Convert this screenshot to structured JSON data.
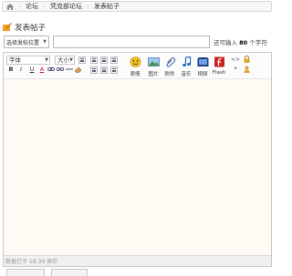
{
  "breadcrumb": {
    "items": [
      "论坛",
      "凭克部论坛",
      "发表帖子"
    ]
  },
  "header": {
    "title": "发表帖子"
  },
  "form": {
    "location_select": "选择发帖位置",
    "subject_value": "",
    "char_hint_prefix": "还可输入 ",
    "char_hint_count": "80",
    "char_hint_suffix": " 个字符"
  },
  "toolbar": {
    "font_label": "字体",
    "size_label": "大小",
    "bold": "B",
    "italic": "I",
    "underline": "U",
    "font_color": "A",
    "emoji_label": "表情",
    "image_label": "图片",
    "attachment_label": "附件",
    "music_label": "音乐",
    "video_label": "视频",
    "flash_label": "Flash",
    "code_symbol": "<>",
    "quote_symbol": "❝"
  },
  "status": {
    "autosave_text": "数据已于 18:39 保存"
  },
  "colors": {
    "content_bg": "#fdfbf4",
    "header_icon": "#f0a020",
    "flash_red": "#cc2222"
  }
}
